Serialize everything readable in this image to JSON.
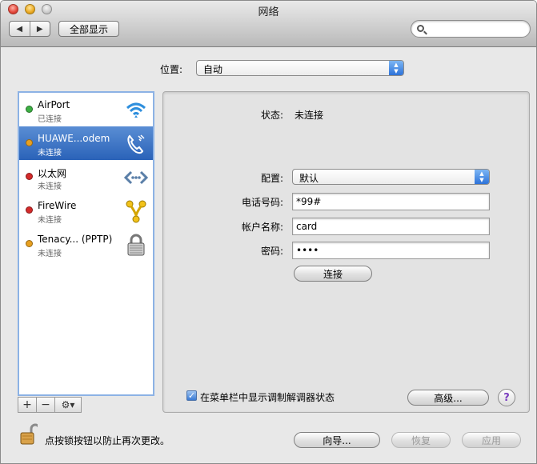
{
  "window": {
    "title": "网络"
  },
  "toolbar": {
    "back": "◀",
    "forward": "▶",
    "show_all": "全部显示",
    "search_placeholder": ""
  },
  "location": {
    "label": "位置:",
    "value": "自动"
  },
  "services": [
    {
      "name": "AirPort",
      "status": "已连接",
      "dot_color": "#3cb043",
      "icon": "wifi-icon",
      "selected": false
    },
    {
      "name": "HUAWE...odem",
      "status": "未连接",
      "dot_color": "#e8a020",
      "icon": "phone-modem-icon",
      "selected": true
    },
    {
      "name": "以太网",
      "status": "未连接",
      "dot_color": "#d42a2a",
      "icon": "ethernet-icon",
      "selected": false
    },
    {
      "name": "FireWire",
      "status": "未连接",
      "dot_color": "#d42a2a",
      "icon": "firewire-icon",
      "selected": false
    },
    {
      "name": "Tenacy... (PPTP)",
      "status": "未连接",
      "dot_color": "#e8a020",
      "icon": "vpn-lock-icon",
      "selected": false
    }
  ],
  "list_tools": {
    "add": "+",
    "remove": "−",
    "gear": "⚙▾"
  },
  "detail": {
    "status_label": "状态:",
    "status_value": "未连接",
    "config_label": "配置:",
    "config_value": "默认",
    "phone_label": "电话号码:",
    "phone_value": "*99#",
    "account_label": "帐户名称:",
    "account_value": "card",
    "password_label": "密码:",
    "password_value": "••••",
    "connect_button": "连接",
    "show_modem_checkbox": "在菜单栏中显示调制解调器状态",
    "show_modem_checked": true,
    "advanced_button": "高级...",
    "help_button": "?"
  },
  "footer": {
    "lock_text": "点按锁按钮以防止再次更改。",
    "assist_button": "向导...",
    "revert_button": "恢复",
    "apply_button": "应用"
  },
  "colors": {
    "selection": "#2a62b8",
    "list_focus_ring": "#8cb2e5",
    "help_glyph": "#7b3fbf"
  }
}
